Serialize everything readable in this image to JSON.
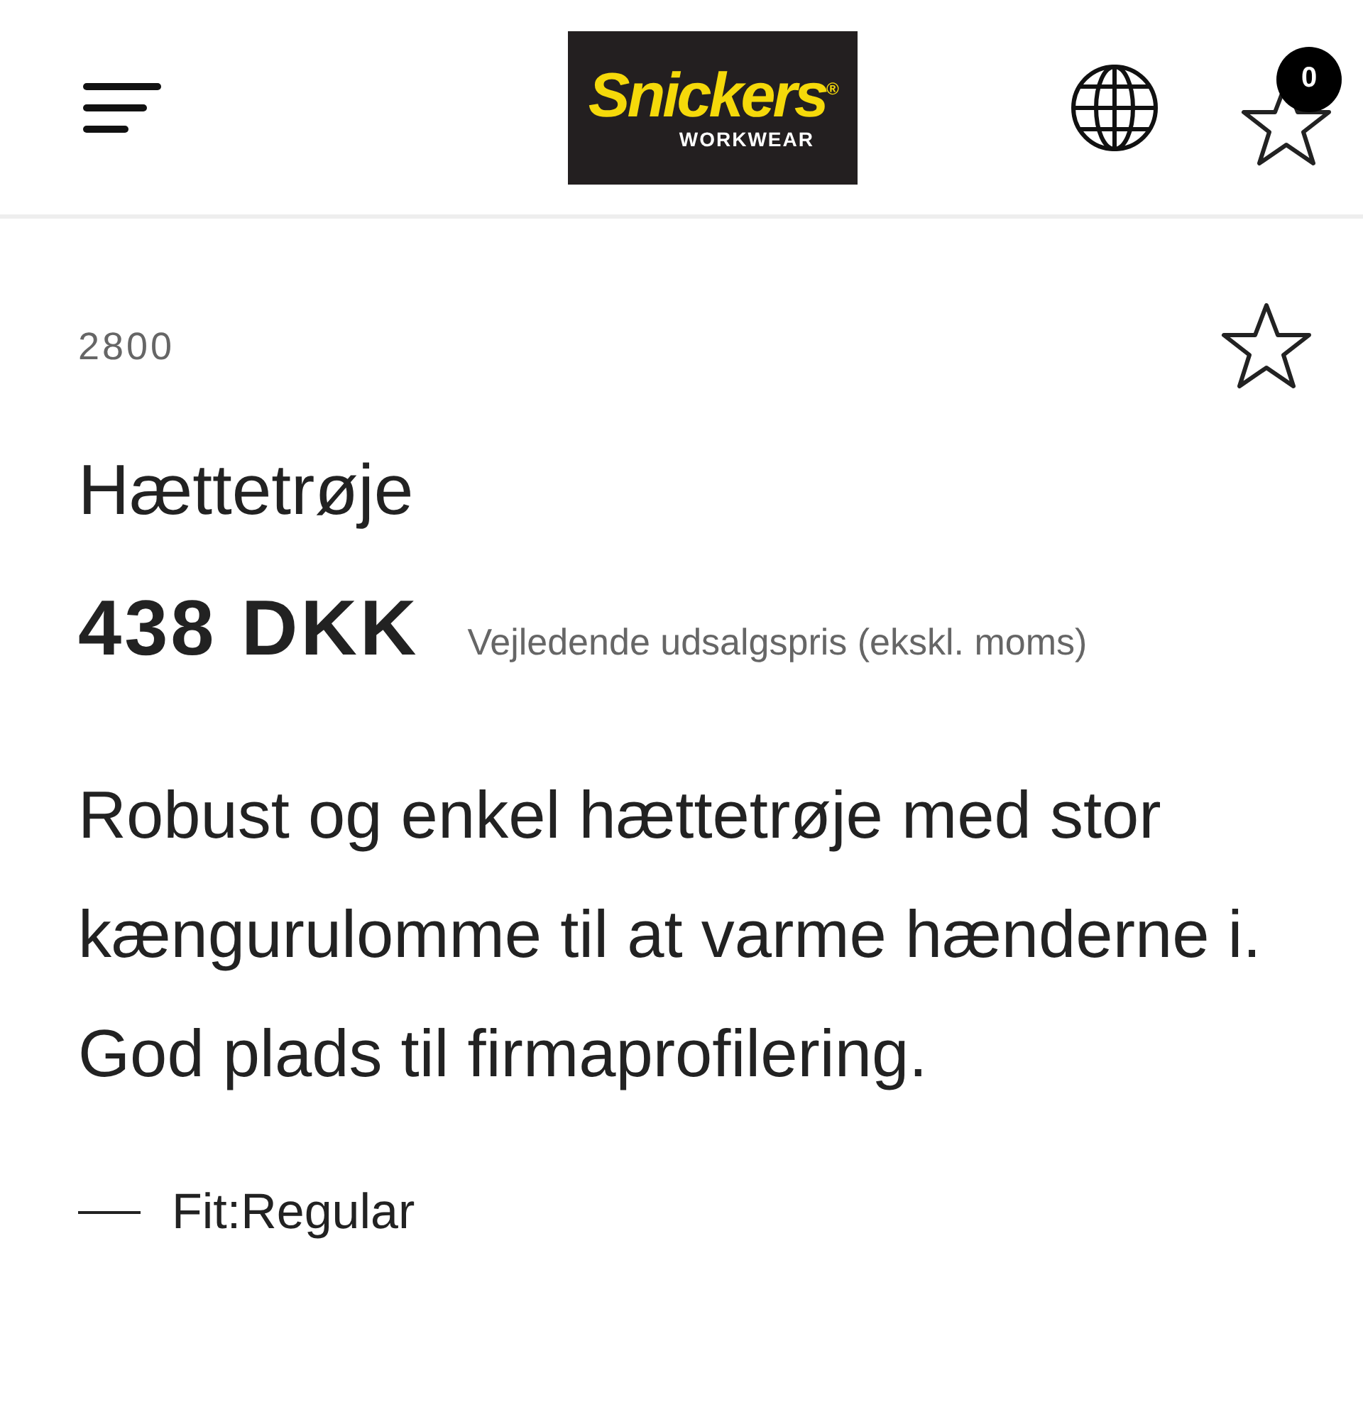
{
  "header": {
    "logo": {
      "brand": "Snickers",
      "mark": "®",
      "tagline": "WORKWEAR"
    },
    "favorites_count": "0"
  },
  "product": {
    "number": "2800",
    "favorite": false,
    "title": "Hættetrøje",
    "price": "438 DKK",
    "price_note": "Vejledende udsalgspris (ekskl. moms)",
    "description": "Robust og enkel hættetrøje med stor kængurulomme til at varme hænderne i. God plads til firmaprofilering.",
    "features": [
      "Fit:Regular"
    ]
  }
}
